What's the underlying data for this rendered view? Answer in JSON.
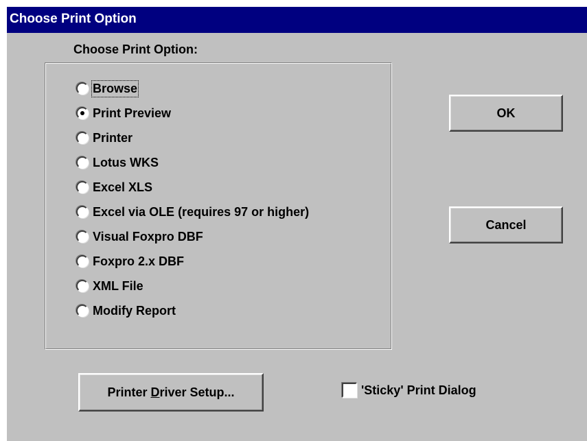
{
  "window": {
    "title": "Choose Print Option"
  },
  "group": {
    "label": "Choose Print Option:",
    "selected": "Print Preview",
    "options": [
      {
        "label": "Browse"
      },
      {
        "label": "Print Preview"
      },
      {
        "label": "Printer"
      },
      {
        "label": "Lotus WKS"
      },
      {
        "label": "Excel XLS"
      },
      {
        "label": "Excel via OLE (requires 97 or higher)"
      },
      {
        "label": "Visual Foxpro DBF"
      },
      {
        "label": "Foxpro 2.x DBF"
      },
      {
        "label": "XML File"
      },
      {
        "label": "Modify Report"
      }
    ]
  },
  "buttons": {
    "ok": "OK",
    "cancel": "Cancel",
    "printer_setup_prefix": "Printer ",
    "printer_setup_accel": "D",
    "printer_setup_suffix": "river Setup..."
  },
  "sticky": {
    "label": "'Sticky' Print Dialog",
    "checked": false
  },
  "colors": {
    "titlebar": "#000080",
    "face": "#c0c0c0"
  }
}
